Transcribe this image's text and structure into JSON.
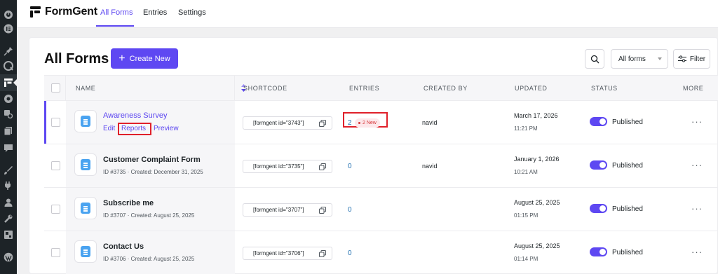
{
  "topbar": {
    "brand": "FormGent",
    "tabs": [
      {
        "label": "All Forms",
        "active": true
      },
      {
        "label": "Entries",
        "active": false
      },
      {
        "label": "Settings",
        "active": false
      }
    ]
  },
  "header": {
    "title": "All Forms",
    "create_label": "Create New",
    "filter_select_value": "All forms",
    "filter_label": "Filter"
  },
  "table": {
    "columns": {
      "name": "NAME",
      "shortcode": "SHORTCODE",
      "entries": "ENTRIES",
      "created_by": "CREATED BY",
      "updated": "UPDATED",
      "status": "STATUS",
      "more": "MORE"
    },
    "rows": [
      {
        "title": "Awareness Survey",
        "actions": {
          "edit": "Edit",
          "reports": "Reports",
          "preview": "Preview"
        },
        "shortcode": "[formgent id=\"3743\"]",
        "entries": "2",
        "new_badge": "2 New",
        "created_by": "navid",
        "updated_date": "March 17, 2026",
        "updated_time": "11:21 PM",
        "status": "Published",
        "more": "···"
      },
      {
        "title": "Customer Complaint Form",
        "meta": "ID #3735 · Created: December 31, 2025",
        "shortcode": "[formgent id=\"3735\"]",
        "entries": "0",
        "created_by": "navid",
        "updated_date": "January 1, 2026",
        "updated_time": "10:21 AM",
        "status": "Published",
        "more": "···"
      },
      {
        "title": "Subscribe me",
        "meta": "ID #3707 · Created: August 25, 2025",
        "shortcode": "[formgent id=\"3707\"]",
        "entries": "0",
        "created_by": "",
        "updated_date": "August 25, 2025",
        "updated_time": "01:15 PM",
        "status": "Published",
        "more": "···"
      },
      {
        "title": "Contact Us",
        "meta": "ID #3706 · Created: August 25, 2025",
        "shortcode": "[formgent id=\"3706\"]",
        "entries": "0",
        "created_by": "",
        "updated_date": "August 25, 2025",
        "updated_time": "01:14 PM",
        "status": "Published",
        "more": "···"
      }
    ]
  },
  "colors": {
    "accent": "#5e48f2",
    "link": "#2271b1",
    "highlight_box": "#e0202a",
    "wp_sidebar": "#1d2327"
  },
  "icons": [
    "dashboard-icon",
    "elementor-icon",
    "pin-icon",
    "comments-icon",
    "formgent-icon",
    "circle-icon",
    "search-gear-icon",
    "pages-icon",
    "comment-icon",
    "appearance-icon",
    "plugins-icon",
    "users-icon",
    "tools-icon",
    "settings-icon",
    "wp-logo-icon"
  ]
}
